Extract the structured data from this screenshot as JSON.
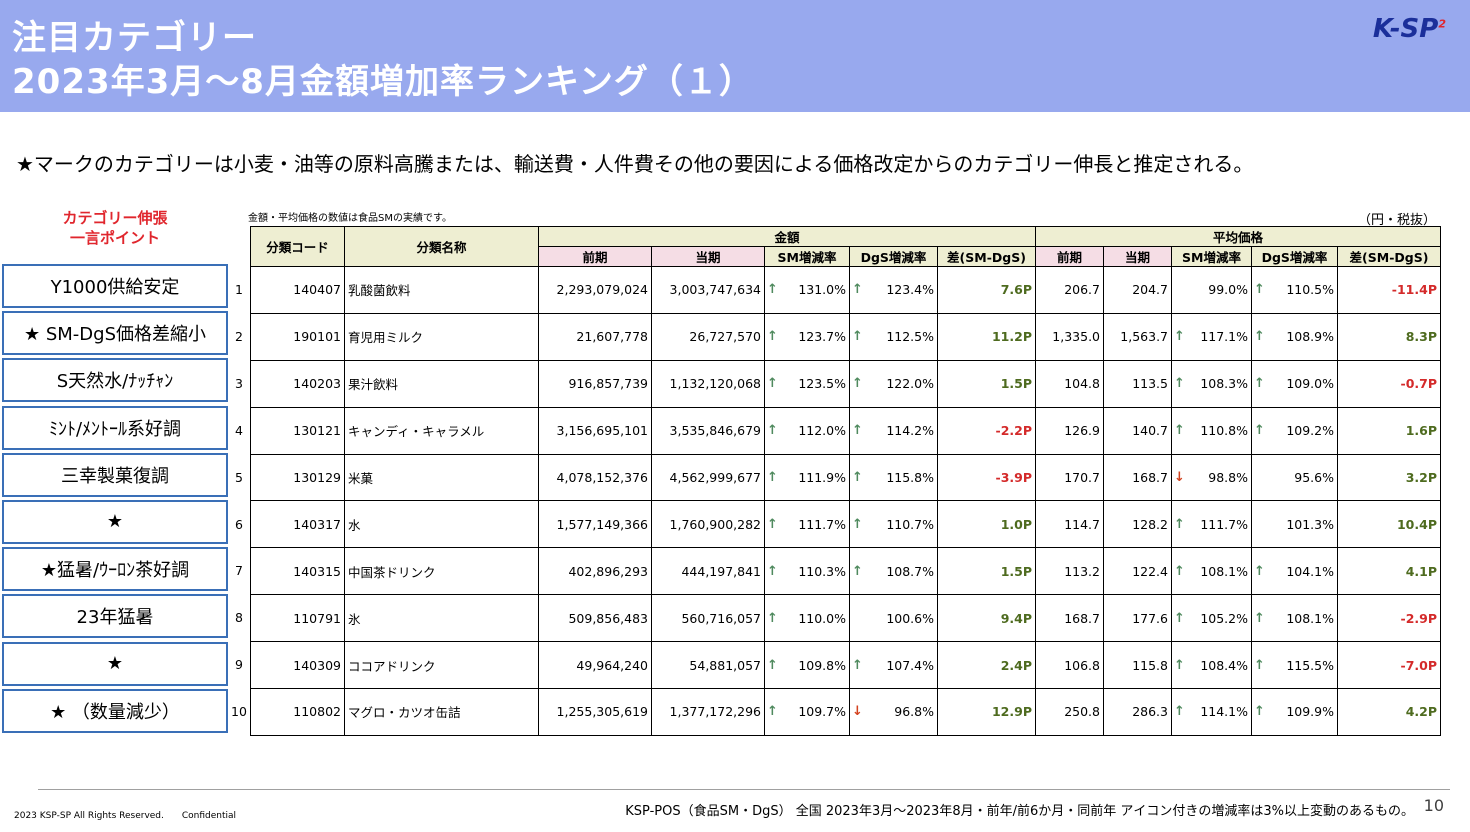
{
  "header": {
    "title_line1": "注目カテゴリー",
    "title_line2": "2023年3月～8月金額増加率ランキング（１）",
    "logo": "K-SP",
    "logo_sup": "2"
  },
  "note": "★マークのカテゴリーは小麦・油等の原料高騰または、輸送費・人件費その他の要因による価格改定からのカテゴリー伸長と推定される。",
  "points_header": [
    "カテゴリー伸張",
    "一言ポイント"
  ],
  "points": [
    "Y1000供給安定",
    "★ SM-DgS価格差縮小",
    "S天然水/ﾅｯﾁｬﾝ",
    "ﾐﾝﾄ/ﾒﾝﾄｰﾙ系好調",
    "三幸製菓復調",
    "★",
    "★猛暑/ｳｰﾛﾝ茶好調",
    "23年猛暑",
    "★",
    "★ （数量減少）"
  ],
  "table_note": "金額・平均価格の数値は食品SMの実績です。",
  "unit": "（円・税抜）",
  "table": {
    "headers": {
      "code": "分類コード",
      "name": "分類名称",
      "amount_group": "金額",
      "price_group": "平均価格",
      "prev": "前期",
      "curr": "当期",
      "sm": "SM増減率",
      "dgs": "DgS増減率",
      "diff": "差(SM-DgS)"
    },
    "rows": [
      {
        "no": "1",
        "code": "140407",
        "name": "乳酸菌飲料",
        "a_prev": "2,293,079,024",
        "a_curr": "3,003,747,634",
        "a_sm": "131.0%",
        "a_sm_icon": "up",
        "a_dgs": "123.4%",
        "a_dgs_icon": "up",
        "a_diff": "7.6P",
        "a_sign": "pos",
        "p_prev": "206.7",
        "p_curr": "204.7",
        "p_sm": "99.0%",
        "p_sm_icon": "",
        "p_dgs": "110.5%",
        "p_dgs_icon": "up",
        "p_diff": "-11.4P",
        "p_sign": "neg"
      },
      {
        "no": "2",
        "code": "190101",
        "name": "育児用ミルク",
        "a_prev": "21,607,778",
        "a_curr": "26,727,570",
        "a_sm": "123.7%",
        "a_sm_icon": "up",
        "a_dgs": "112.5%",
        "a_dgs_icon": "up",
        "a_diff": "11.2P",
        "a_sign": "pos",
        "p_prev": "1,335.0",
        "p_curr": "1,563.7",
        "p_sm": "117.1%",
        "p_sm_icon": "up",
        "p_dgs": "108.9%",
        "p_dgs_icon": "up",
        "p_diff": "8.3P",
        "p_sign": "pos"
      },
      {
        "no": "3",
        "code": "140203",
        "name": "果汁飲料",
        "a_prev": "916,857,739",
        "a_curr": "1,132,120,068",
        "a_sm": "123.5%",
        "a_sm_icon": "up",
        "a_dgs": "122.0%",
        "a_dgs_icon": "up",
        "a_diff": "1.5P",
        "a_sign": "pos",
        "p_prev": "104.8",
        "p_curr": "113.5",
        "p_sm": "108.3%",
        "p_sm_icon": "up",
        "p_dgs": "109.0%",
        "p_dgs_icon": "up",
        "p_diff": "-0.7P",
        "p_sign": "neg"
      },
      {
        "no": "4",
        "code": "130121",
        "name": "キャンディ・キャラメル",
        "a_prev": "3,156,695,101",
        "a_curr": "3,535,846,679",
        "a_sm": "112.0%",
        "a_sm_icon": "up",
        "a_dgs": "114.2%",
        "a_dgs_icon": "up",
        "a_diff": "-2.2P",
        "a_sign": "neg",
        "p_prev": "126.9",
        "p_curr": "140.7",
        "p_sm": "110.8%",
        "p_sm_icon": "up",
        "p_dgs": "109.2%",
        "p_dgs_icon": "up",
        "p_diff": "1.6P",
        "p_sign": "pos"
      },
      {
        "no": "5",
        "code": "130129",
        "name": "米菓",
        "a_prev": "4,078,152,376",
        "a_curr": "4,562,999,677",
        "a_sm": "111.9%",
        "a_sm_icon": "up",
        "a_dgs": "115.8%",
        "a_dgs_icon": "up",
        "a_diff": "-3.9P",
        "a_sign": "neg",
        "p_prev": "170.7",
        "p_curr": "168.7",
        "p_sm": "98.8%",
        "p_sm_icon": "down",
        "p_dgs": "95.6%",
        "p_dgs_icon": "",
        "p_diff": "3.2P",
        "p_sign": "pos"
      },
      {
        "no": "6",
        "code": "140317",
        "name": "水",
        "a_prev": "1,577,149,366",
        "a_curr": "1,760,900,282",
        "a_sm": "111.7%",
        "a_sm_icon": "up",
        "a_dgs": "110.7%",
        "a_dgs_icon": "up",
        "a_diff": "1.0P",
        "a_sign": "pos",
        "p_prev": "114.7",
        "p_curr": "128.2",
        "p_sm": "111.7%",
        "p_sm_icon": "up",
        "p_dgs": "101.3%",
        "p_dgs_icon": "",
        "p_diff": "10.4P",
        "p_sign": "pos"
      },
      {
        "no": "7",
        "code": "140315",
        "name": "中国茶ドリンク",
        "a_prev": "402,896,293",
        "a_curr": "444,197,841",
        "a_sm": "110.3%",
        "a_sm_icon": "up",
        "a_dgs": "108.7%",
        "a_dgs_icon": "up",
        "a_diff": "1.5P",
        "a_sign": "pos",
        "p_prev": "113.2",
        "p_curr": "122.4",
        "p_sm": "108.1%",
        "p_sm_icon": "up",
        "p_dgs": "104.1%",
        "p_dgs_icon": "up",
        "p_diff": "4.1P",
        "p_sign": "pos"
      },
      {
        "no": "8",
        "code": "110791",
        "name": "氷",
        "a_prev": "509,856,483",
        "a_curr": "560,716,057",
        "a_sm": "110.0%",
        "a_sm_icon": "up",
        "a_dgs": "100.6%",
        "a_dgs_icon": "",
        "a_diff": "9.4P",
        "a_sign": "pos",
        "p_prev": "168.7",
        "p_curr": "177.6",
        "p_sm": "105.2%",
        "p_sm_icon": "up",
        "p_dgs": "108.1%",
        "p_dgs_icon": "up",
        "p_diff": "-2.9P",
        "p_sign": "neg"
      },
      {
        "no": "9",
        "code": "140309",
        "name": "ココアドリンク",
        "a_prev": "49,964,240",
        "a_curr": "54,881,057",
        "a_sm": "109.8%",
        "a_sm_icon": "up",
        "a_dgs": "107.4%",
        "a_dgs_icon": "up",
        "a_diff": "2.4P",
        "a_sign": "pos",
        "p_prev": "106.8",
        "p_curr": "115.8",
        "p_sm": "108.4%",
        "p_sm_icon": "up",
        "p_dgs": "115.5%",
        "p_dgs_icon": "up",
        "p_diff": "-7.0P",
        "p_sign": "neg"
      },
      {
        "no": "10",
        "code": "110802",
        "name": "マグロ・カツオ缶詰",
        "a_prev": "1,255,305,619",
        "a_curr": "1,377,172,296",
        "a_sm": "109.7%",
        "a_sm_icon": "up",
        "a_dgs": "96.8%",
        "a_dgs_icon": "down",
        "a_diff": "12.9P",
        "a_sign": "pos",
        "p_prev": "250.8",
        "p_curr": "286.3",
        "p_sm": "114.1%",
        "p_sm_icon": "up",
        "p_dgs": "109.9%",
        "p_dgs_icon": "up",
        "p_diff": "4.2P",
        "p_sign": "pos"
      }
    ]
  },
  "footer": {
    "copyright": "2023 KSP-SP All Rights Reserved.　　Confidential",
    "source": "KSP-POS（食品SM・DgS） 全国 2023年3月～2023年8月・前年/前6か月・同前年 アイコン付きの増減率は3%以上変動のあるもの。",
    "page": "10"
  },
  "colors": {
    "header_bg": "#98a9ee",
    "accent_red": "#e0262d",
    "box_border": "#3a6fb7",
    "positive": "#4e6b1f",
    "negative": "#d42a2a",
    "arrow_up": "#4f8a5e",
    "arrow_down": "#d3421f"
  }
}
